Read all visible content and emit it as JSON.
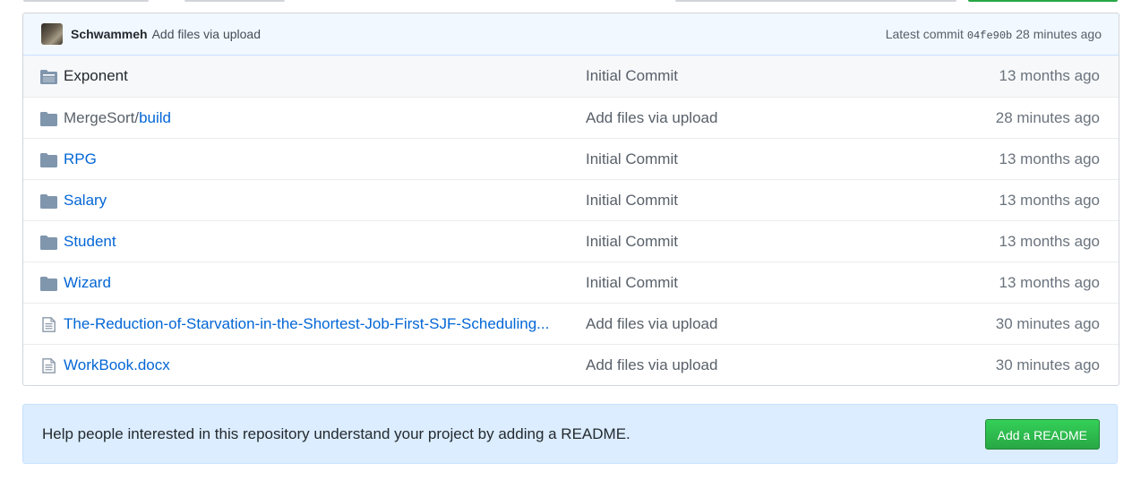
{
  "commit_bar": {
    "author": "Schwammeh",
    "message": "Add files via upload",
    "latest_label": "Latest commit",
    "sha": "04fe90b",
    "age": "28 minutes ago"
  },
  "files": [
    {
      "type": "dir",
      "icon": "folder-open-icon",
      "prefix": "",
      "name": "Exponent",
      "message": "Initial Commit",
      "age": "13 months ago"
    },
    {
      "type": "dir",
      "icon": "folder-icon",
      "prefix": "MergeSort/",
      "name": "build",
      "message": "Add files via upload",
      "age": "28 minutes ago"
    },
    {
      "type": "dir",
      "icon": "folder-icon",
      "prefix": "",
      "name": "RPG",
      "message": "Initial Commit",
      "age": "13 months ago"
    },
    {
      "type": "dir",
      "icon": "folder-icon",
      "prefix": "",
      "name": "Salary",
      "message": "Initial Commit",
      "age": "13 months ago"
    },
    {
      "type": "dir",
      "icon": "folder-icon",
      "prefix": "",
      "name": "Student",
      "message": "Initial Commit",
      "age": "13 months ago"
    },
    {
      "type": "dir",
      "icon": "folder-icon",
      "prefix": "",
      "name": "Wizard",
      "message": "Initial Commit",
      "age": "13 months ago"
    },
    {
      "type": "file",
      "icon": "file-icon",
      "prefix": "",
      "name": "The-Reduction-of-Starvation-in-the-Shortest-Job-First-SJF-Scheduling...",
      "message": "Add files via upload",
      "age": "30 minutes ago"
    },
    {
      "type": "file",
      "icon": "file-icon",
      "prefix": "",
      "name": "WorkBook.docx",
      "message": "Add files via upload",
      "age": "30 minutes ago"
    }
  ],
  "readme_prompt": {
    "text": "Help people interested in this repository understand your project by adding a README.",
    "button_label": "Add a README"
  },
  "colors": {
    "link": "#0366d6",
    "commit_bar_bg": "#f1f8ff",
    "readme_bg": "#dbedff",
    "button_green": "#28a745",
    "folder_icon": "#79b8ff"
  }
}
